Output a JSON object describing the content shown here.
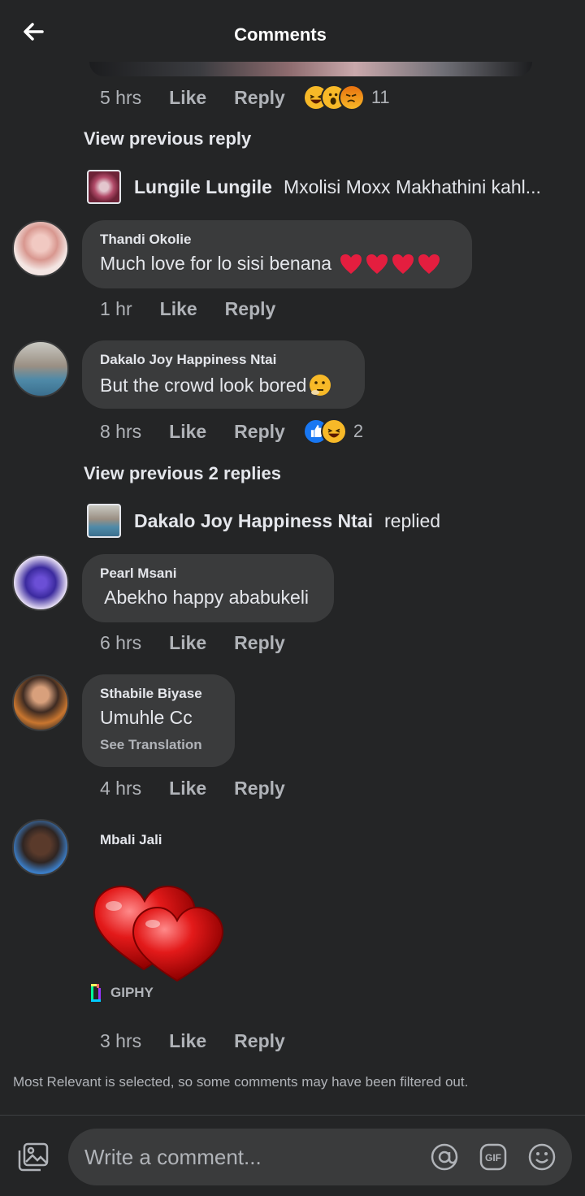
{
  "header": {
    "title": "Comments"
  },
  "top_meta": {
    "time": "5 hrs",
    "like": "Like",
    "reply": "Reply",
    "reaction_count": "11"
  },
  "view_prev_1": "View previous reply",
  "reply_line_1": {
    "name": "Lungile Lungile",
    "text": "Mxolisi Moxx Makhathini kahl..."
  },
  "comments": [
    {
      "author": "Thandi Okolie",
      "text": "Much love for lo sisi benana",
      "time": "1 hr",
      "like": "Like",
      "reply": "Reply"
    },
    {
      "author": "Dakalo Joy Happiness Ntai",
      "text": "But the crowd look bored",
      "time": "8 hrs",
      "like": "Like",
      "reply": "Reply",
      "reaction_count": "2"
    },
    {
      "author": "Pearl Msani",
      "text": " Abekho happy ababukeli",
      "time": "6 hrs",
      "like": "Like",
      "reply": "Reply"
    },
    {
      "author": "Sthabile Biyase",
      "text": "Umuhle Cc",
      "see_translation": "See Translation",
      "time": "4 hrs",
      "like": "Like",
      "reply": "Reply"
    },
    {
      "author": "Mbali Jali",
      "giphy": "GIPHY",
      "time": "3 hrs",
      "like": "Like",
      "reply": "Reply"
    }
  ],
  "view_prev_2": "View previous 2 replies",
  "reply_line_2": {
    "name": "Dakalo Joy Happiness Ntai",
    "text": "replied"
  },
  "footer_note": "Most Relevant is selected, so some comments may have been filtered out.",
  "composer": {
    "placeholder": "Write a comment..."
  },
  "colors": {
    "background": "#242526",
    "bubble": "#3a3b3c",
    "like_blue": "#1877f2",
    "heart_red": "#e41e3f"
  }
}
